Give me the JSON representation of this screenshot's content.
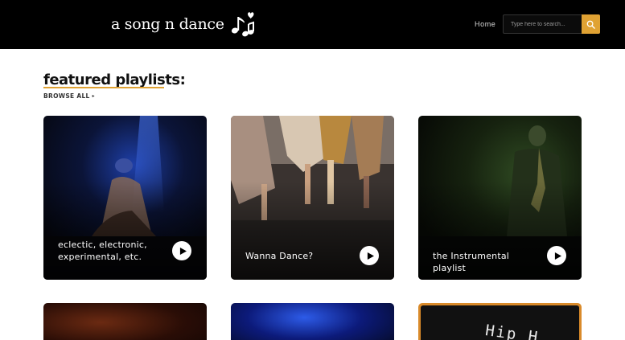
{
  "header": {
    "logo_text": "a song n dance",
    "nav_home": "Home",
    "search_placeholder": "Type here to search...",
    "search_icon": "search-icon"
  },
  "featured": {
    "title": "featured playlists:",
    "browse_all": "BROWSE ALL",
    "browse_arrow": "▸"
  },
  "playlists": [
    {
      "title_line1": "eclectic, electronic,",
      "title_line2": "experimental, etc.",
      "icon": "play-icon"
    },
    {
      "title": "Wanna Dance?",
      "icon": "play-icon"
    },
    {
      "title": "the Instrumental playlist",
      "icon": "play-icon"
    }
  ],
  "more_playlists": [
    {
      "visible_text": ""
    },
    {
      "visible_text": ""
    },
    {
      "visible_text": "Hip H"
    }
  ],
  "colors": {
    "accent": "#e0a233",
    "header_bg": "#000000"
  }
}
